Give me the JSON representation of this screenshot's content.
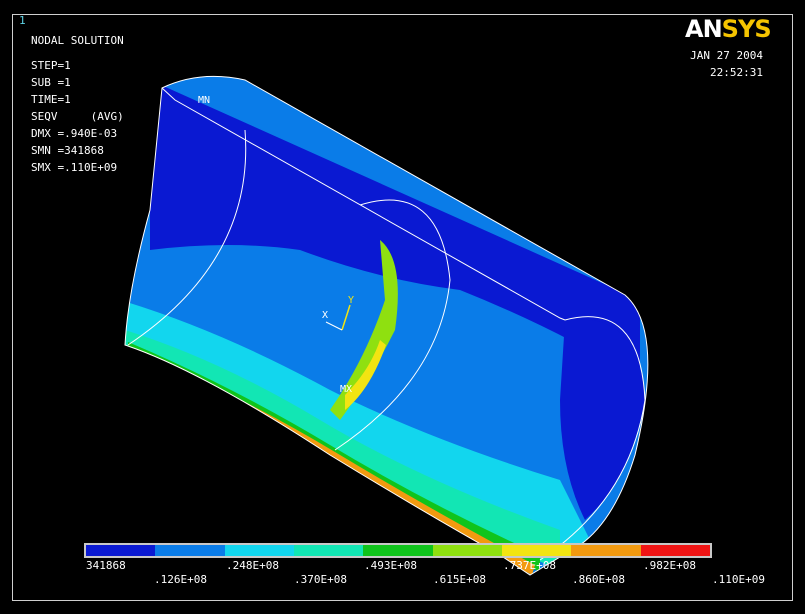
{
  "window_number": "1",
  "title": "NODAL SOLUTION",
  "stats": [
    "STEP=1",
    "SUB =1",
    "TIME=1",
    "SEQV     (AVG)",
    "DMX =.940E-03",
    "SMN =341868",
    "SMX =.110E+09"
  ],
  "brand": {
    "part1": "AN",
    "part2": "SYS"
  },
  "date": "JAN 27 2004",
  "time": "22:52:31",
  "markers": {
    "min": "MN",
    "max": "MX"
  },
  "triad": {
    "x": "X",
    "y": "Y"
  },
  "legend": {
    "colors": [
      "#0a19d2",
      "#0a7ce8",
      "#12d6ee",
      "#12e6b4",
      "#10c41c",
      "#8fe010",
      "#f2e412",
      "#f29a10",
      "#f01414"
    ],
    "top_labels": [
      "341868",
      ".248E+08",
      ".493E+08",
      ".737E+08",
      ".982E+08"
    ],
    "bottom_labels": [
      ".126E+08",
      ".370E+08",
      ".615E+08",
      ".860E+08",
      ".110E+09"
    ]
  }
}
